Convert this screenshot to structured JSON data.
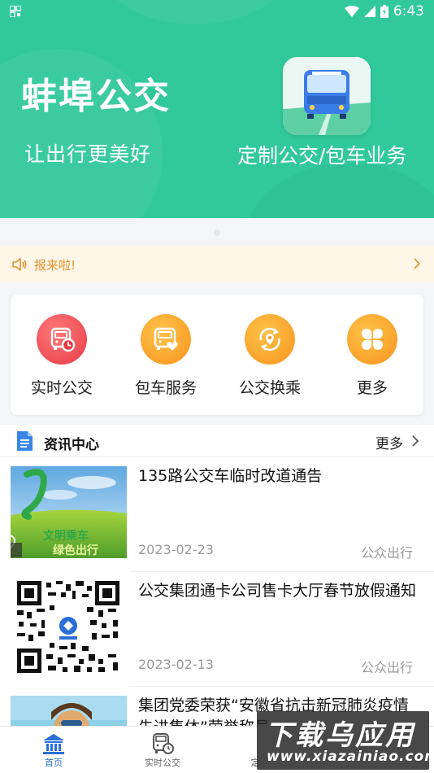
{
  "status_bar": {
    "time": "6:43"
  },
  "banner": {
    "title": "蚌埠公交",
    "subtitle": "让出行更美好",
    "feature_text": "定制公交/包车业务"
  },
  "notice": {
    "text": "报来啦!"
  },
  "quick_actions": [
    {
      "label": "实时公交",
      "icon": "bus-clock-icon",
      "color": "#e63946"
    },
    {
      "label": "包车服务",
      "icon": "bus-heart-icon",
      "color": "#f7941d"
    },
    {
      "label": "公交换乘",
      "icon": "transfer-location-icon",
      "color": "#f7941d"
    },
    {
      "label": "更多",
      "icon": "grid-more-icon",
      "color": "#f7941d"
    }
  ],
  "news": {
    "section_title": "资讯中心",
    "more_label": "更多",
    "items": [
      {
        "title": "135路公交车临时改道通告",
        "date": "2023-02-23",
        "source": "公众出行",
        "thumb_text_1": "文明乘车",
        "thumb_text_2": "绿色出行"
      },
      {
        "title": "公交集团通卡公司售卡大厅春节放假通知",
        "date": "2023-02-13",
        "source": "公众出行"
      },
      {
        "title": "集团党委荣获“安徽省抗击新冠肺炎疫情先进集体”荣誉称号",
        "date": "",
        "source": ""
      }
    ]
  },
  "tabbar": {
    "items": [
      {
        "label": "首页",
        "icon": "home-icon"
      },
      {
        "label": "实时公交",
        "icon": "bus-tab-icon"
      },
      {
        "label": "定",
        "icon": "custom-bus-tab-icon"
      }
    ]
  },
  "watermark": {
    "main": "下载乌应用",
    "sub": "www.xiazainiao.com"
  },
  "colors": {
    "brand_green": "#31c99a",
    "active_blue": "#2a6fd8",
    "notice_orange": "#e8922a"
  }
}
